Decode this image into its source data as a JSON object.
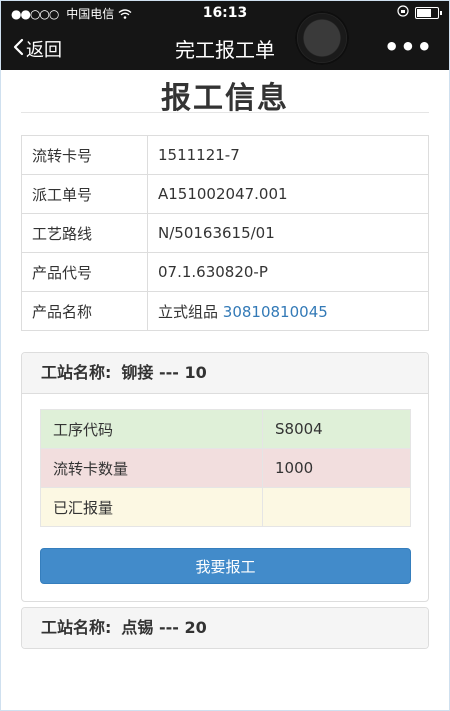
{
  "status_bar": {
    "carrier": "中国电信",
    "time": "16:13"
  },
  "nav": {
    "back_label": "返回",
    "title": "完工报工单"
  },
  "page": {
    "heading": "报工信息"
  },
  "info_rows": [
    {
      "label": "流转卡号",
      "value": "1511121-7"
    },
    {
      "label": "派工单号",
      "value": "A151002047.001"
    },
    {
      "label": "工艺路线",
      "value": "N/50163615/01"
    },
    {
      "label": "产品代号",
      "value": "07.1.630820-P"
    },
    {
      "label": "产品名称",
      "value": "立式组品",
      "link": "30810810045"
    }
  ],
  "stations": [
    {
      "label": "工站名称:",
      "name": "铆接 --- 10",
      "rows": [
        {
          "label": "工序代码",
          "value": "S8004",
          "color": "#dff0d8"
        },
        {
          "label": "流转卡数量",
          "value": "1000",
          "color": "#f2dede"
        },
        {
          "label": "已汇报量",
          "value": "",
          "color": "#fcf8e3"
        }
      ],
      "button_label": "我要报工"
    },
    {
      "label": "工站名称:",
      "name": "点锡 --- 20"
    }
  ],
  "colors": {
    "primary_button": "#428bca",
    "link": "#337ab7",
    "topbar": "#151515"
  }
}
